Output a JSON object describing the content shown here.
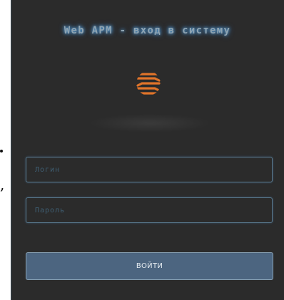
{
  "login_form": {
    "title": "Web APM - вход в систему",
    "logo_icon": "striped-globe-logo-icon",
    "accent_color": "#e0742a",
    "username_placeholder": "Логин",
    "username_value": "",
    "password_placeholder": "Пароль",
    "password_value": "",
    "submit_label": "ВОЙТИ"
  },
  "background_fragments": {
    "comma": ","
  }
}
